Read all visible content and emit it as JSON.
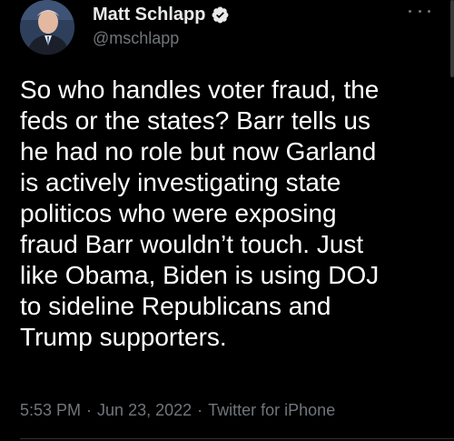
{
  "author": {
    "display_name": "Matt Schlapp",
    "handle": "@mschlapp",
    "verified": true,
    "avatar_icon": "profile-photo"
  },
  "tweet": {
    "text": "So who handles voter fraud, the\nfeds or the states?  Barr tells us\nhe had no role but now Garland\nis actively investigating state\npoliticos who were exposing\nfraud Barr wouldn’t touch. Just\nlike Obama, Biden is using DOJ\nto sideline Republicans and\nTrump supporters.",
    "time": "5:53 PM",
    "date": "Jun 23, 2022",
    "source": "Twitter for iPhone",
    "separator": "·"
  },
  "colors": {
    "background": "#000000",
    "text": "#ffffff",
    "secondary": "#71767b",
    "verified": "#1d9bf0"
  },
  "icons": {
    "verified": "verified-badge-icon",
    "more": "more-options-icon"
  }
}
